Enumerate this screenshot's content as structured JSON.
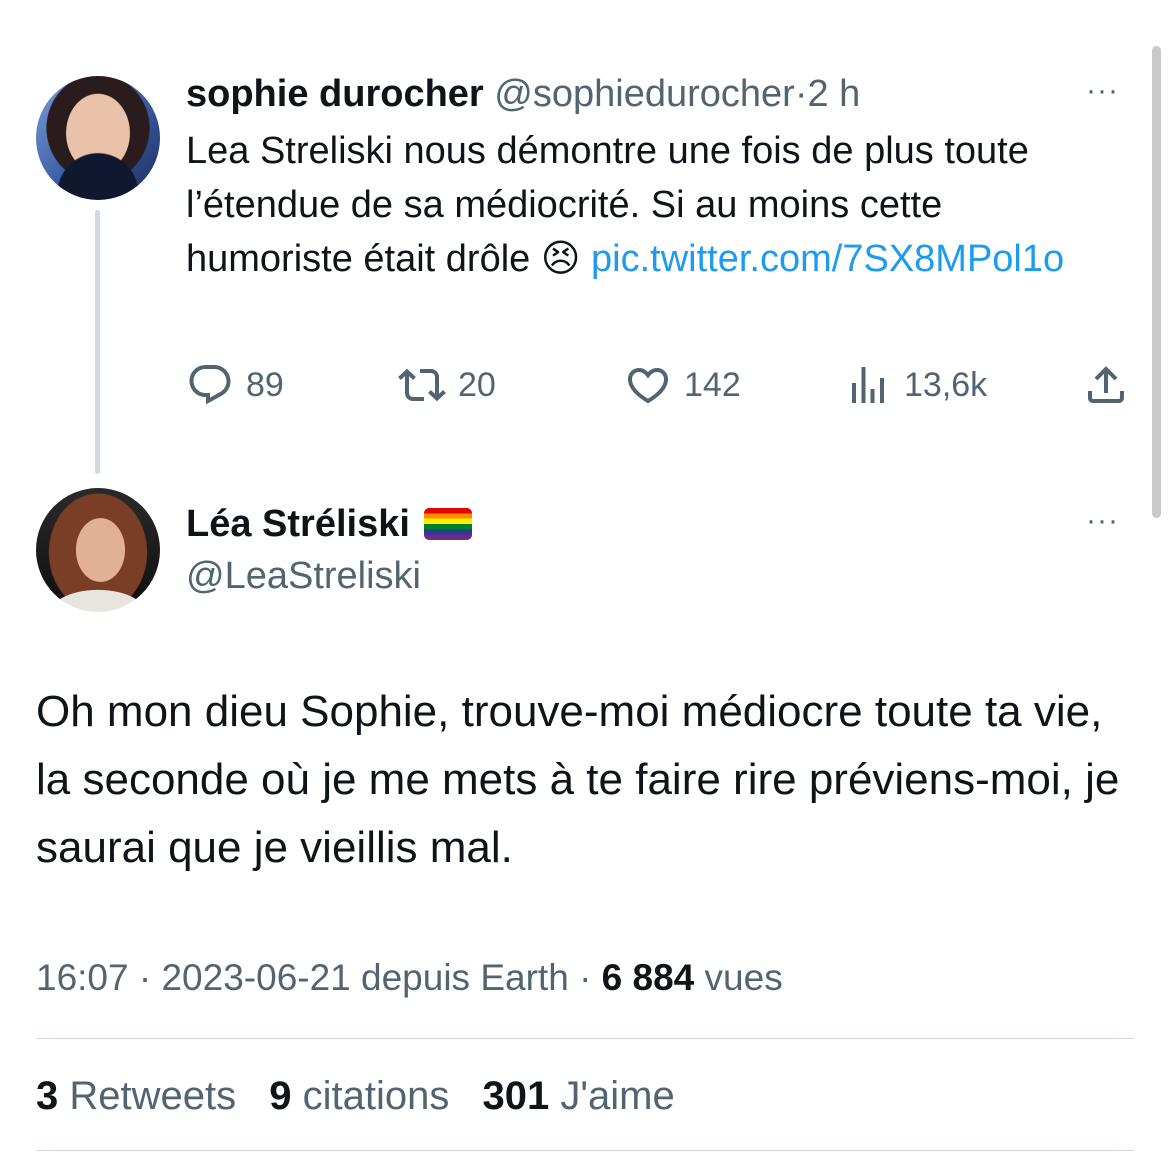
{
  "tweet1": {
    "name": "sophie durocher",
    "handle": "@sophiedurocher",
    "dot": "·",
    "time": "2 h",
    "text": "Lea Streliski nous démontre une fois de plus toute l’étendue de sa médiocrité. Si au moins cette humoriste était drôle",
    "emoji": "😣",
    "link": "pic.twitter.com/7SX8MPol1o",
    "more": "···",
    "actions": {
      "replies": "89",
      "retweets": "20",
      "likes": "142",
      "views": "13,6k"
    }
  },
  "tweet2": {
    "name": "Léa Stréliski",
    "handle": "@LeaStreliski",
    "more": "···",
    "text": "Oh mon dieu Sophie, trouve-moi médiocre toute ta vie, la seconde où je me mets à te faire rire préviens-moi, je saurai que je vieillis mal.",
    "meta": {
      "time": "16:07",
      "sep1": "·",
      "date": "2023-06-21",
      "source": "depuis Earth",
      "sep2": "·",
      "views_count": "6 884",
      "views_label": "vues"
    },
    "stats": {
      "retweets_count": "3",
      "retweets_label": "Retweets",
      "quotes_count": "9",
      "quotes_label": "citations",
      "likes_count": "301",
      "likes_label": "J'aime"
    }
  },
  "colors": {
    "text": "#0f1419",
    "muted": "#536471",
    "link": "#1d9bf0",
    "divider": "#cfd9de"
  }
}
